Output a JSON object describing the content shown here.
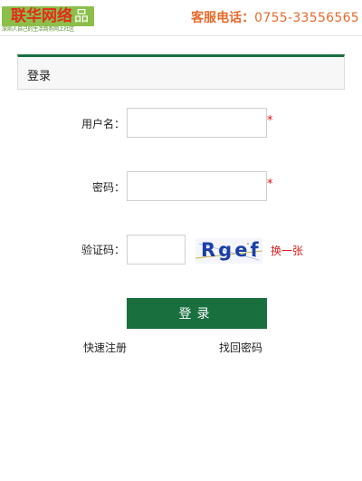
{
  "header": {
    "logo_text": "联华网络",
    "logo_char": "品",
    "logo_slogan": "深圳人自己的生活商务网上社区",
    "service_label": "客服电话：",
    "service_phone": "0755-33556565"
  },
  "panel": {
    "title": "登录"
  },
  "form": {
    "username_label": "用户名：",
    "username_value": "",
    "password_label": "密码：",
    "password_value": "",
    "captcha_label": "验证码：",
    "captcha_value": "",
    "captcha_text": "Rgef",
    "required_mark": "*",
    "refresh_label": "换一张",
    "submit_label": "登录"
  },
  "links": {
    "register": "快速注册",
    "forgot": "找回密码"
  },
  "colors": {
    "brand_green": "#1a6f3f",
    "logo_green": "#8bbf4a",
    "phone_orange": "#e8692a",
    "required_red": "#e01010"
  }
}
